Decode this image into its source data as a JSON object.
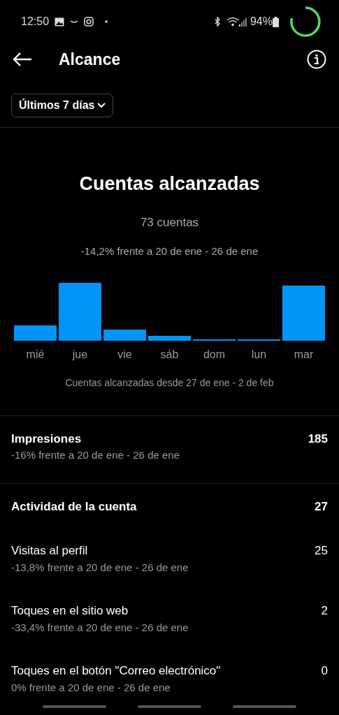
{
  "status_bar": {
    "time": "12:50",
    "battery": "94%"
  },
  "header": {
    "title": "Alcance"
  },
  "period_filter": {
    "label": "Últimos 7 días"
  },
  "reach": {
    "title": "Cuentas alcanzadas",
    "count": "73 cuentas",
    "comparison": "-14,2% frente a 20 de ene - 26 de ene",
    "day_labels": [
      "mié",
      "jue",
      "vie",
      "sáb",
      "dom",
      "lun",
      "mar"
    ],
    "caption": "Cuentas alcanzadas desde 27 de ene - 2 de feb"
  },
  "impressions": {
    "label": "Impresiones",
    "value": "185",
    "comparison": "-16% frente a 20 de ene - 26 de ene"
  },
  "activity": {
    "label": "Actividad de la cuenta",
    "value": "27",
    "items": [
      {
        "label": "Visitas al perfil",
        "value": "25",
        "comparison": "-13,8% frente a 20 de ene - 26 de ene"
      },
      {
        "label": "Toques en el sitio web",
        "value": "2",
        "comparison": "-33,4% frente a 20 de ene - 26 de ene"
      },
      {
        "label": "Toques en el botón \"Correo electrónico\"",
        "value": "0",
        "comparison": "0% frente a 20 de ene - 26 de ene"
      }
    ]
  }
}
